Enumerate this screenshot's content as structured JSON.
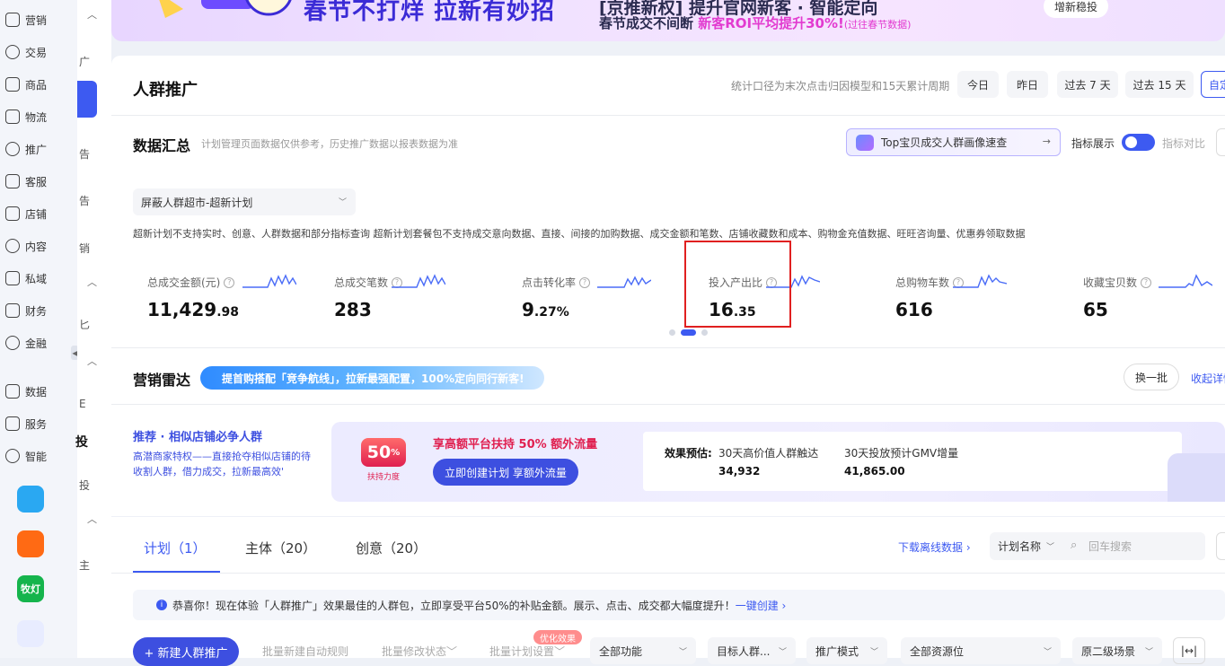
{
  "nav": {
    "items": [
      {
        "label": "营销",
        "icon": "megaphone-icon"
      },
      {
        "label": "交易",
        "icon": "document-icon"
      },
      {
        "label": "商品",
        "icon": "bag-icon"
      },
      {
        "label": "物流",
        "icon": "truck-icon"
      },
      {
        "label": "推广",
        "icon": "location-icon"
      },
      {
        "label": "客服",
        "icon": "headset-icon"
      },
      {
        "label": "店铺",
        "icon": "store-icon"
      },
      {
        "label": "内容",
        "icon": "hash-icon"
      },
      {
        "label": "私域",
        "icon": "people-icon"
      },
      {
        "label": "财务",
        "icon": "yen-icon"
      },
      {
        "label": "金融",
        "icon": "circle-icon"
      },
      {
        "label": "数据",
        "icon": "chart-icon"
      },
      {
        "label": "服务",
        "icon": "grid-icon"
      },
      {
        "label": "智能",
        "icon": "bolt-icon"
      }
    ],
    "apps": [
      {
        "name": "app-shark",
        "color": "#2aa8f2",
        "text": ""
      },
      {
        "name": "app-bag",
        "color": "#ff6a14",
        "text": ""
      },
      {
        "name": "app-qiandeng",
        "color": "#15b44c",
        "text": "牧灯"
      },
      {
        "name": "app-crm",
        "color": "#e8ecff",
        "text": ""
      }
    ]
  },
  "subnav": {
    "fragments": [
      "广",
      "告",
      "告",
      "销",
      "匕",
      "E",
      "投",
      "投",
      "主"
    ],
    "bold_fragment": "投"
  },
  "banner": {
    "headline": "春节不打烊 拉新有妙招",
    "line1": "[京推新权] 提升官网新客 · 智能定向",
    "line2_a": "春节成交不间断 ",
    "line2_b": "新客ROI平均提升30%!",
    "line2_c": "(过往春节数据)",
    "button": "增新稳投"
  },
  "header": {
    "title": "人群推广",
    "note": "统计口径为末次点击归因模型和15天累计周期",
    "ranges": [
      "今日",
      "昨日",
      "过去 7 天",
      "过去 15 天",
      "自定"
    ]
  },
  "summary": {
    "title": "数据汇总",
    "subtitle": "计划管理页面数据仅供参考，历史推广数据以报表数据为准",
    "top_button": "Top宝贝成交人群画像速查",
    "toggle_label": "指标展示",
    "compare_label": "指标对比",
    "plan_select": "屏蔽人群超市-超新计划",
    "warning": "超新计划不支持实时、创意、人群数据和部分指标查询 超新计划套餐包不支持成交意向数据、直接、间接的加购数据、成交金额和笔数、店铺收藏数和成本、购物金充值数据、旺旺咨询量、优惠券领取数据",
    "metrics": [
      {
        "label": "总成交金额(元)",
        "int": "11,429",
        "dec": ".98"
      },
      {
        "label": "总成交笔数",
        "int": "283",
        "dec": ""
      },
      {
        "label": "点击转化率",
        "int": "9",
        "dec": ".27%"
      },
      {
        "label": "投入产出比",
        "int": "16",
        "dec": ".35"
      },
      {
        "label": "总购物车数",
        "int": "616",
        "dec": ""
      },
      {
        "label": "收藏宝贝数",
        "int": "65",
        "dec": ""
      }
    ],
    "highlight_color": "#e02020"
  },
  "radar": {
    "title": "营销雷达",
    "tag": "提首购搭配「竞争航线」，拉新最强配置，100%定向同行新客!",
    "refresh": "换一批",
    "collapse": "收起详情",
    "rec_title": "推荐 · 相似店铺必争人群",
    "rec_desc": "高潜商家特权——直接抢夺相似店铺的待收割人群，借力成交，拉新最高效'",
    "badge_num": "50",
    "badge_pct": "%",
    "badge_text": "扶持力度",
    "offer": "享高额平台扶持 50% 额外流量",
    "cta": "立即创建计划 享额外流量",
    "est_label": "效果预估:",
    "est1_label": "30天高价值人群触达",
    "est1_value": "34,932",
    "est2_label": "30天投放预计GMV增量",
    "est2_value": "41,865.00"
  },
  "tabs": [
    {
      "label": "计划（1）"
    },
    {
      "label": "主体（20）"
    },
    {
      "label": "创意（20）"
    }
  ],
  "list": {
    "download": "下载离线数据",
    "field_select": "计划名称",
    "search_placeholder": "回车搜索",
    "notice": "恭喜你！现在体验「人群推广」效果最佳的人群包，立即享受平台50%的补贴金额。展示、点击、成交都大幅度提升！",
    "notice_link": "一键创建",
    "new_button": "+ 新建人群推广",
    "batch1": "批量新建自动规则",
    "batch2": "批量修改状态",
    "batch3": "批量计划设置",
    "opt_tag": "优化效果",
    "filters": [
      "全部功能",
      "目标人群...",
      "推广模式",
      "全部资源位",
      "原二级场景"
    ]
  }
}
